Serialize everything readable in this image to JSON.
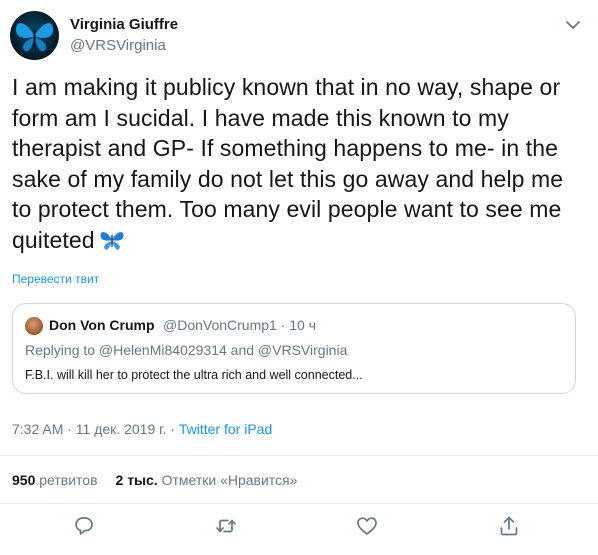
{
  "author": {
    "name": "Virginia Giuffre",
    "handle": "@VRSVirginia"
  },
  "tweet": {
    "text": "I am making it publicy known that in no way, shape or form am I sucidal. I have made this known to my therapist and GP- If something happens to me- in the sake of my family do not let this go away and help me to protect them. Too many evil people want to see me quiteted",
    "emoji": "butterfly",
    "translate_label": "Перевести твит"
  },
  "quoted": {
    "name": "Don Von Crump",
    "handle_time": "@DonVonCrump1 · 10 ч",
    "replying_to": "Replying to @HelenMi84029314 and @VRSVirginia",
    "text": "F.B.I. will kill her to protect the ultra rich and well connected..."
  },
  "meta": {
    "timestamp": "7:32 AM · 11 дек. 2019 г. · ",
    "source": "Twitter for iPad"
  },
  "stats": {
    "retweets_count": "950",
    "retweets_label": "ретвитов",
    "likes_count": "2 тыс.",
    "likes_label": "Отметки «Нравится»"
  },
  "icons": {
    "caret": "chevron-down-icon",
    "reply": "reply-icon",
    "retweet": "retweet-icon",
    "like": "heart-icon",
    "share": "share-icon"
  },
  "colors": {
    "link": "#1b95e0",
    "secondary": "#657786",
    "primary_text": "#14171a",
    "border": "#ccd6dd",
    "butterfly": "#1d7fd8"
  }
}
